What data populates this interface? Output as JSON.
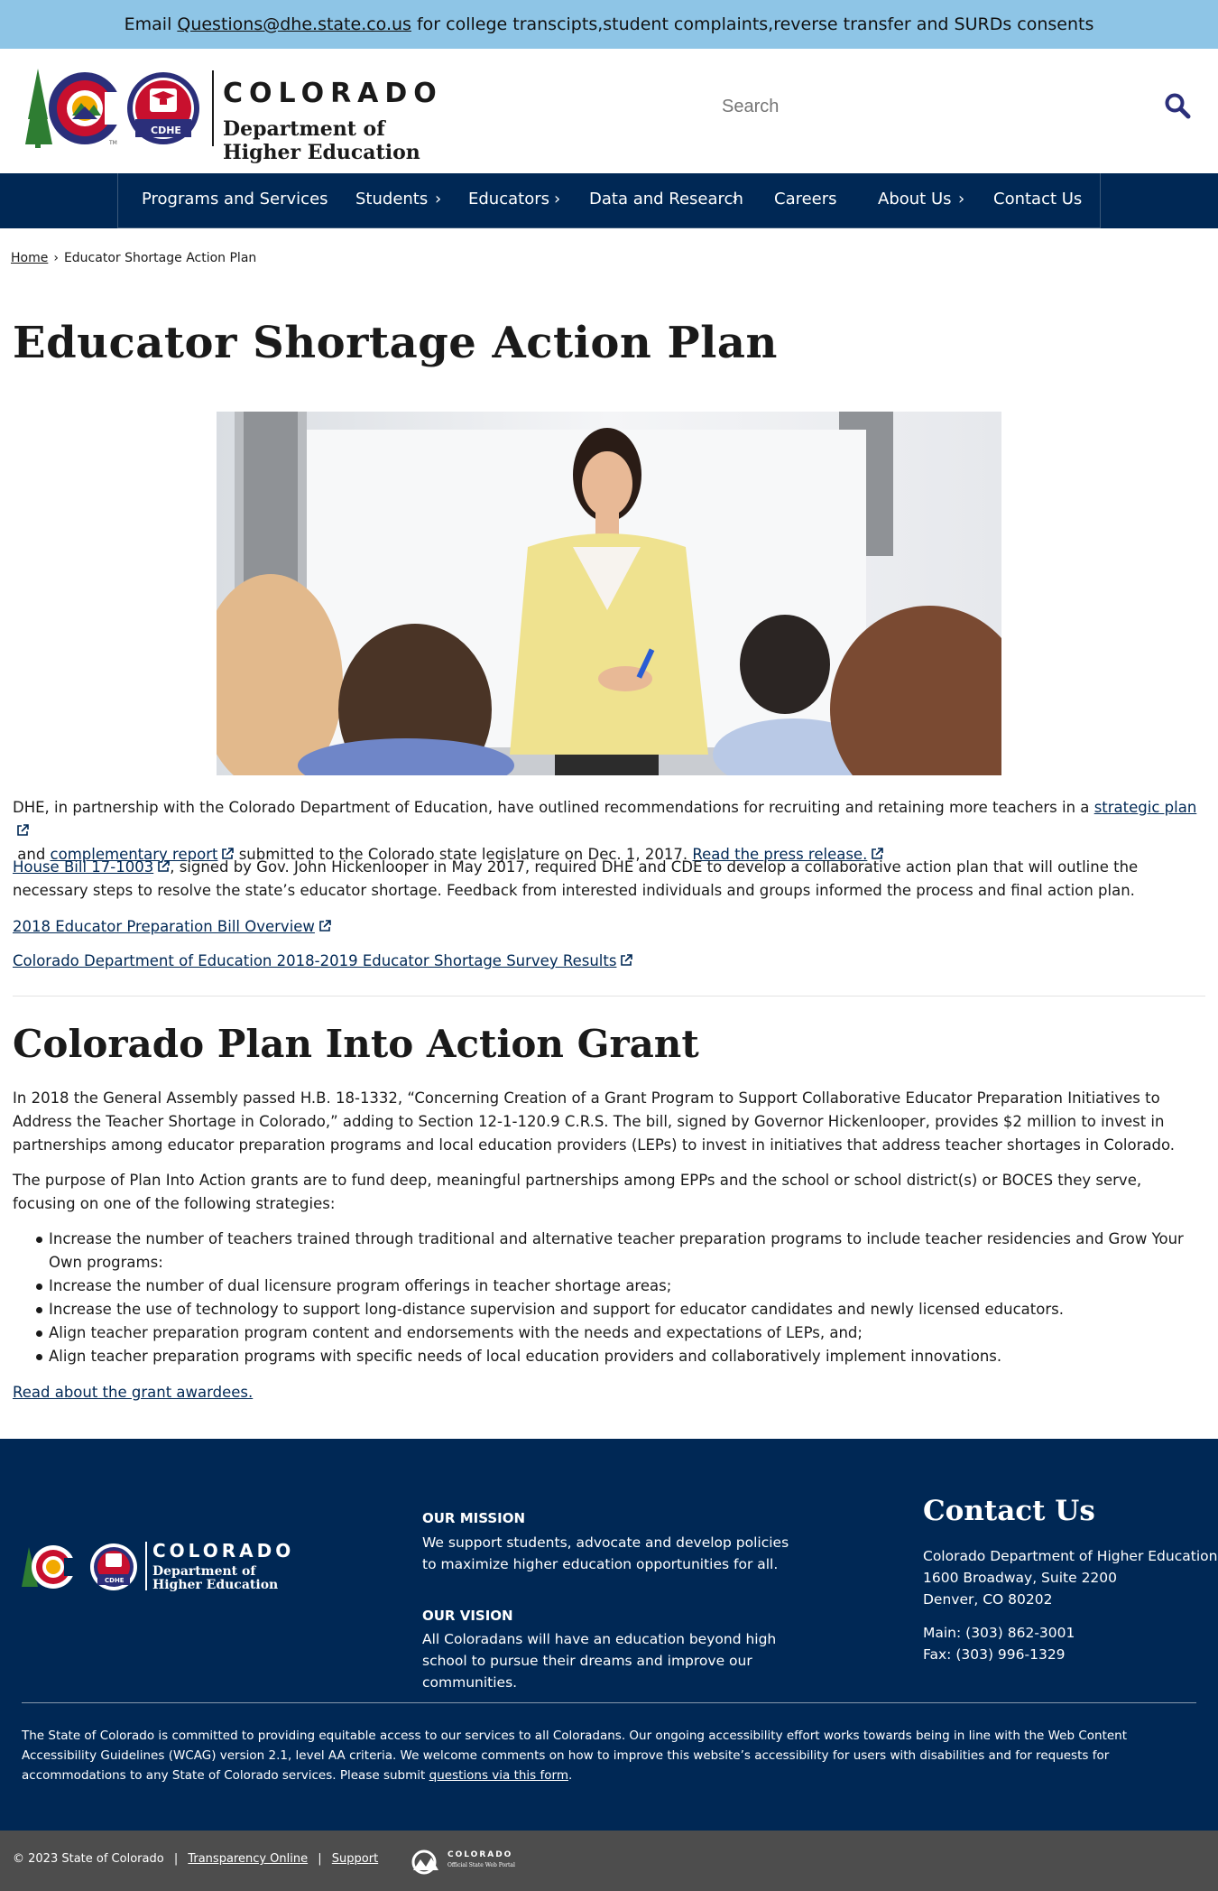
{
  "alert": {
    "prefix": "Email",
    "email": "Questions@dhe.state.co.us",
    "suffix": "for college transcipts,student complaints,reverse transfer and SURDs consents"
  },
  "header": {
    "brand_state": "COLORADO",
    "brand_dept_line1": "Department of",
    "brand_dept_line2": "Higher Education",
    "logo_badge": "CDHE",
    "logo_tm": "TM",
    "search_placeholder": "Search"
  },
  "nav": {
    "items": [
      {
        "label": "Programs and Services",
        "has_submenu": false
      },
      {
        "label": "Students",
        "has_submenu": true
      },
      {
        "label": "Educators",
        "has_submenu": true
      },
      {
        "label": "Data and Research",
        "has_submenu": true
      },
      {
        "label": "Careers",
        "has_submenu": false
      },
      {
        "label": "About Us",
        "has_submenu": true
      },
      {
        "label": "Contact Us",
        "has_submenu": false
      }
    ],
    "chevron": "›"
  },
  "breadcrumb": {
    "home": "Home",
    "separator": "›",
    "current": "Educator Shortage Action Plan"
  },
  "page": {
    "title": "Educator Shortage Action Plan",
    "p1": {
      "t1": "DHE, in partnership with the Colorado Department of Education, have outlined recommendations for recruiting and retaining more teachers in a",
      "link1": "strategic plan",
      "t2": "and",
      "link2": "complementary report",
      "t3": "submitted to the Colorado state legislature on Dec. 1, 2017.",
      "link3": "Read the press release."
    },
    "p2": {
      "link": "House Bill 17-1003",
      "text": ", signed by Gov. John Hickenlooper in May 2017, required DHE and CDE to develop a collaborative action plan that will outline the necessary steps to resolve the state’s educator shortage. Feedback from interested individuals and groups informed the process and final action plan."
    },
    "link_overview": "2018 Educator Preparation Bill Overview",
    "link_survey": "Colorado Department of Education 2018-2019 Educator Shortage Survey Results",
    "section2_title": "Colorado Plan Into Action Grant",
    "p3": "In 2018 the General Assembly passed H.B. 18-1332, “Concerning Creation of a Grant Program to Support Collaborative Educator Preparation Initiatives to Address the Teacher Shortage in Colorado,” adding to Section 12-1-120.9 C.R.S. The bill, signed by Governor Hickenlooper, provides $2 million to invest in partnerships among educator preparation programs and local education providers (LEPs) to invest in initiatives that address teacher shortages in Colorado.",
    "p4": "The purpose of Plan Into Action grants are to fund deep, meaningful partnerships among EPPs and the school or school district(s) or BOCES they serve, focusing on one of the following strategies:",
    "strategies": [
      "Increase the number of teachers trained through traditional and alternative teacher preparation programs to include teacher residencies and Grow Your Own programs:",
      "Increase the number of dual licensure program offerings in teacher shortage areas;",
      "Increase the use of technology to support long-distance supervision and support for educator candidates and newly licensed educators.",
      "Align teacher preparation program content and endorsements with the needs and expectations of LEPs, and;",
      "Align teacher preparation programs with specific needs of local education providers and collaboratively implement innovations."
    ],
    "link_awardees": "Read about the grant awardees."
  },
  "footer": {
    "brand_state": "COLORADO",
    "brand_dept_line1": "Department of",
    "brand_dept_line2": "Higher Education",
    "logo_badge": "CDHE",
    "mission_heading": "OUR MISSION",
    "mission_text": "We support students, advocate and develop policies to maximize higher education opportunities for all.",
    "vision_heading": "OUR VISION",
    "vision_text": "All Coloradans will have an education beyond high school to pursue their dreams and improve our communities.",
    "contact_heading": "Contact Us",
    "address_line1": "Colorado Department of Higher Education",
    "address_line2": "1600 Broadway, Suite 2200",
    "address_line3": "Denver, CO 80202",
    "main_phone": "Main: (303) 862-3001",
    "fax": "Fax: (303) 996-1329",
    "accessibility_text": "The State of Colorado is committed to providing equitable access to our services to all Coloradans. Our ongoing accessibility effort works towards being in line with the Web Content Accessibility Guidelines (WCAG) version 2.1, level AA criteria. We welcome comments on how to improve this website’s accessibility for users with disabilities and for requests for accommodations to any State of Colorado services. Please submit",
    "accessibility_link": "questions via this form",
    "accessibility_end": "."
  },
  "bottom_bar": {
    "copyright": "© 2023 State of Colorado",
    "pipe": "|",
    "link_transparency": "Transparency Online",
    "link_support": "Support",
    "portal_title": "COLORADO",
    "portal_sub": "Official State Web Portal"
  },
  "colors": {
    "navy": "#002855",
    "alert_blue": "#8ec5e6",
    "bottom_gray": "#4d4d4d",
    "logo_red": "#c8102e",
    "logo_green": "#2e7d32",
    "logo_blue": "#2b2f7a",
    "logo_gold": "#f2a900"
  },
  "icons": [
    "search-icon",
    "external-link-icon",
    "chevron-right-icon",
    "colorado-c-logo-icon",
    "cdhe-badge-icon",
    "tree-icon",
    "state-portal-logo-icon"
  ]
}
